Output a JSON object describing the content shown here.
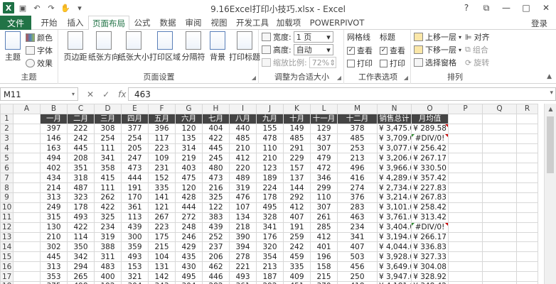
{
  "title": "9.16Excel打印小技巧.xlsx - Excel",
  "window": {
    "help": "?",
    "restore": "⧉",
    "minimize": "—",
    "maximize": "□",
    "close": "✕"
  },
  "tabs": {
    "file": "文件",
    "items": [
      "开始",
      "插入",
      "页面布局",
      "公式",
      "数据",
      "审阅",
      "视图",
      "开发工具",
      "加载项",
      "POWERPIVOT"
    ],
    "active": "页面布局",
    "login": "登录"
  },
  "ribbon": {
    "themes": {
      "theme": "主题",
      "colors": "颜色",
      "fonts": "字体",
      "effects": "效果",
      "label": "主题"
    },
    "page_setup": {
      "margins": "页边距",
      "orientation": "纸张方向",
      "size": "纸张大小",
      "print_area": "打印区域",
      "breaks": "分隔符",
      "background": "背景",
      "print_titles": "打印标题",
      "label": "页面设置"
    },
    "scale_to_fit": {
      "width_label": "宽度:",
      "width_value": "1 页",
      "height_label": "高度:",
      "height_value": "自动",
      "scale_label": "缩放比例:",
      "scale_value": "72%",
      "label": "调整为合适大小"
    },
    "sheet_options": {
      "gridlines": "网格线",
      "headings": "标题",
      "view": "查看",
      "print": "打印",
      "label": "工作表选项"
    },
    "arrange": {
      "bring_forward": "上移一层",
      "send_backward": "下移一层",
      "selection_pane": "选择窗格",
      "align": "对齐",
      "group": "组合",
      "rotate": "旋转",
      "label": "排列"
    }
  },
  "formula_bar": {
    "name_box": "M11",
    "cancel": "✕",
    "enter": "✓",
    "fx": "fx",
    "value": "463"
  },
  "sheet": {
    "columns": [
      "A",
      "B",
      "C",
      "D",
      "E",
      "F",
      "G",
      "H",
      "I",
      "J",
      "K",
      "L",
      "M",
      "N",
      "O",
      "P",
      "Q",
      "R"
    ],
    "row_numbers": [
      "1",
      "2",
      "3",
      "4",
      "5",
      "6",
      "7",
      "8",
      "9",
      "10",
      "11",
      "12",
      "13",
      "14",
      "15",
      "16",
      "17",
      "18",
      "19"
    ],
    "header": [
      "一月",
      "二月",
      "三月",
      "四月",
      "五月",
      "六月",
      "七月",
      "八月",
      "九月",
      "十月",
      "十一月",
      "十二月",
      "销售总计",
      "月均值"
    ],
    "rows": [
      [
        "397",
        "222",
        "308",
        "377",
        "396",
        "120",
        "404",
        "440",
        "155",
        "149",
        "129",
        "378",
        "¥ 3,475.00",
        "¥ 289.58"
      ],
      [
        "146",
        "242",
        "254",
        "254",
        "117",
        "135",
        "422",
        "485",
        "478",
        "485",
        "437",
        "485",
        "¥ 3,709.00",
        "#DIV/0!"
      ],
      [
        "163",
        "445",
        "111",
        "205",
        "223",
        "314",
        "445",
        "210",
        "110",
        "291",
        "307",
        "253",
        "¥ 3,077.00",
        "¥ 256.42"
      ],
      [
        "494",
        "208",
        "341",
        "247",
        "109",
        "219",
        "245",
        "412",
        "210",
        "229",
        "479",
        "213",
        "¥ 3,206.00",
        "¥ 267.17"
      ],
      [
        "402",
        "351",
        "358",
        "473",
        "231",
        "403",
        "480",
        "220",
        "123",
        "157",
        "472",
        "496",
        "¥ 3,966.00",
        "¥ 330.50"
      ],
      [
        "434",
        "318",
        "415",
        "444",
        "152",
        "475",
        "473",
        "489",
        "189",
        "137",
        "346",
        "416",
        "¥ 4,289.00",
        "¥ 357.42"
      ],
      [
        "214",
        "487",
        "111",
        "191",
        "335",
        "120",
        "216",
        "319",
        "224",
        "144",
        "299",
        "274",
        "¥ 2,734.00",
        "¥ 227.83"
      ],
      [
        "313",
        "323",
        "262",
        "170",
        "141",
        "428",
        "325",
        "476",
        "178",
        "292",
        "110",
        "376",
        "¥ 3,214.00",
        "¥ 267.83"
      ],
      [
        "249",
        "178",
        "422",
        "361",
        "121",
        "444",
        "122",
        "107",
        "495",
        "412",
        "307",
        "283",
        "¥ 3,101.00",
        "¥ 258.42"
      ],
      [
        "315",
        "493",
        "325",
        "113",
        "267",
        "272",
        "383",
        "134",
        "328",
        "407",
        "261",
        "463",
        "¥ 3,761.00",
        "¥ 313.42"
      ],
      [
        "130",
        "422",
        "234",
        "439",
        "223",
        "248",
        "439",
        "218",
        "341",
        "191",
        "285",
        "234",
        "¥ 3,404.00",
        "#DIV/0!"
      ],
      [
        "210",
        "114",
        "319",
        "300",
        "175",
        "246",
        "252",
        "390",
        "176",
        "259",
        "412",
        "341",
        "¥ 3,194.00",
        "¥ 266.17"
      ],
      [
        "302",
        "350",
        "388",
        "359",
        "215",
        "429",
        "237",
        "394",
        "320",
        "242",
        "401",
        "407",
        "¥ 4,044.00",
        "¥ 336.83"
      ],
      [
        "445",
        "342",
        "311",
        "493",
        "104",
        "435",
        "206",
        "278",
        "354",
        "459",
        "196",
        "503",
        "¥ 3,928.00",
        "¥ 327.33"
      ],
      [
        "313",
        "294",
        "483",
        "153",
        "131",
        "430",
        "462",
        "221",
        "213",
        "335",
        "158",
        "456",
        "¥ 3,649.00",
        "¥ 304.08"
      ],
      [
        "353",
        "265",
        "400",
        "321",
        "142",
        "495",
        "446",
        "493",
        "187",
        "409",
        "215",
        "250",
        "¥ 3,947.00",
        "¥ 328.92"
      ],
      [
        "375",
        "498",
        "192",
        "304",
        "343",
        "304",
        "282",
        "361",
        "292",
        "451",
        "370",
        "418",
        "¥ 4,181.00",
        "¥ 348.42"
      ]
    ]
  },
  "colors": {
    "file_tab": "#217346",
    "header_fill": "#444444",
    "error_triangle": "#2e8b2e",
    "comment_triangle": "#cc0000"
  }
}
